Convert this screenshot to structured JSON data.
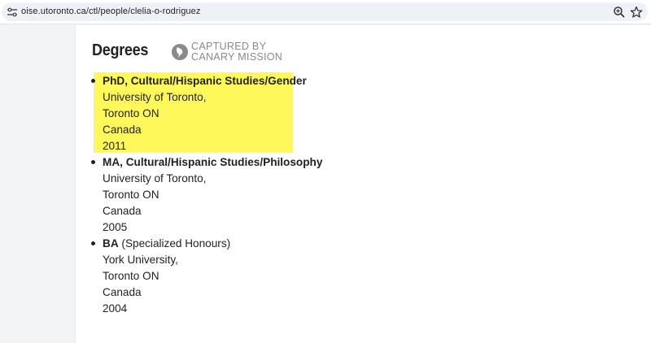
{
  "browser": {
    "url": "oise.utoronto.ca/ctl/people/clelia-o-rodriguez",
    "icons": {
      "site": "site-info-icon",
      "zoom": "zoom-icon",
      "bookmark": "star-icon"
    }
  },
  "main": {
    "heading": "Degrees",
    "watermark": {
      "line1": "CAPTURED BY",
      "line2": "CANARY MISSION"
    },
    "highlight_color": "#fff85a",
    "degrees": [
      {
        "title": "PhD, Cultural/Hispanic Studies/Gender",
        "title_suffix": "",
        "institution": "University of Toronto,",
        "location": "Toronto ON",
        "country": "Canada",
        "year": "2011"
      },
      {
        "title": "MA, Cultural/Hispanic Studies/Philosophy",
        "title_suffix": "",
        "institution": "University of Toronto,",
        "location": "Toronto ON",
        "country": "Canada",
        "year": "2005"
      },
      {
        "title": "BA",
        "title_suffix": " (Specialized Honours)",
        "institution": "York University,",
        "location": "Toronto ON",
        "country": "Canada",
        "year": "2004"
      }
    ]
  }
}
